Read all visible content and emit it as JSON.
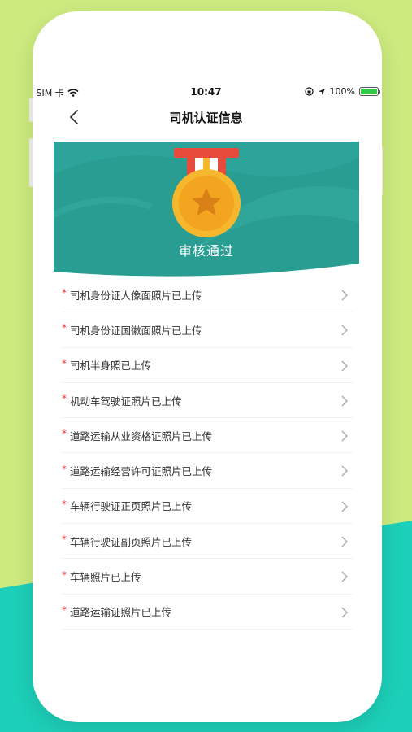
{
  "status_bar": {
    "carrier": "无 SIM 卡",
    "time": "10:47",
    "battery": "100%"
  },
  "nav": {
    "title": "司机认证信息"
  },
  "banner": {
    "status": "审核通过"
  },
  "items": [
    {
      "required": "*",
      "label": "司机身份证人像面照片已上传"
    },
    {
      "required": "*",
      "label": "司机身份证国徽面照片已上传"
    },
    {
      "required": "*",
      "label": "司机半身照已上传"
    },
    {
      "required": "*",
      "label": "机动车驾驶证照片已上传"
    },
    {
      "required": "*",
      "label": "道路运输从业资格证照片已上传"
    },
    {
      "required": "*",
      "label": "道路运输经营许可证照片已上传"
    },
    {
      "required": "*",
      "label": "车辆行驶证正页照片已上传"
    },
    {
      "required": "*",
      "label": "车辆行驶证副页照片已上传"
    },
    {
      "required": "*",
      "label": "车辆照片已上传"
    },
    {
      "required": "*",
      "label": "道路运输证照片已上传"
    }
  ],
  "icons": {
    "back": "chevron-left-icon",
    "row_arrow": "chevron-right-icon",
    "medal": "medal-star-icon"
  },
  "colors": {
    "banner": "#2a9d93",
    "required": "#e33333",
    "bg_green": "#cdeb7f",
    "bg_teal": "#1dd0b9"
  }
}
